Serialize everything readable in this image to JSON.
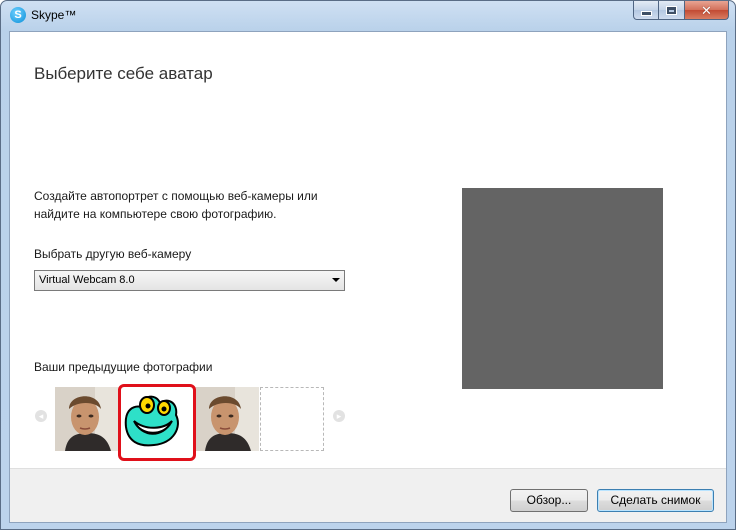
{
  "window": {
    "title": "Skype™",
    "app_icon_glyph": "S",
    "controls": {
      "minimize_icon": "minimize-icon",
      "maximize_icon": "maximize-icon",
      "close_glyph": "✕"
    }
  },
  "page": {
    "heading": "Выберите себе аватар",
    "description": "Создайте автопортрет с помощью веб-камеры или найдите на компьютере свою фотографию.",
    "camera_label": "Выбрать другую веб-камеру",
    "camera_selected": "Virtual Webcam 8.0",
    "previous_photos_label": "Ваши предыдущие фотографии",
    "nav_prev_glyph": "◂",
    "nav_next_glyph": "▸"
  },
  "photos": [
    {
      "kind": "portrait"
    },
    {
      "kind": "frog-avatar",
      "selected": true
    },
    {
      "kind": "portrait"
    },
    {
      "kind": "empty"
    }
  ],
  "preview": {
    "color": "#646464"
  },
  "footer": {
    "browse_label": "Обзор...",
    "snapshot_label": "Сделать снимок"
  },
  "colors": {
    "selection_ring": "#e0101a",
    "default_button_border": "#3c7fb1"
  }
}
